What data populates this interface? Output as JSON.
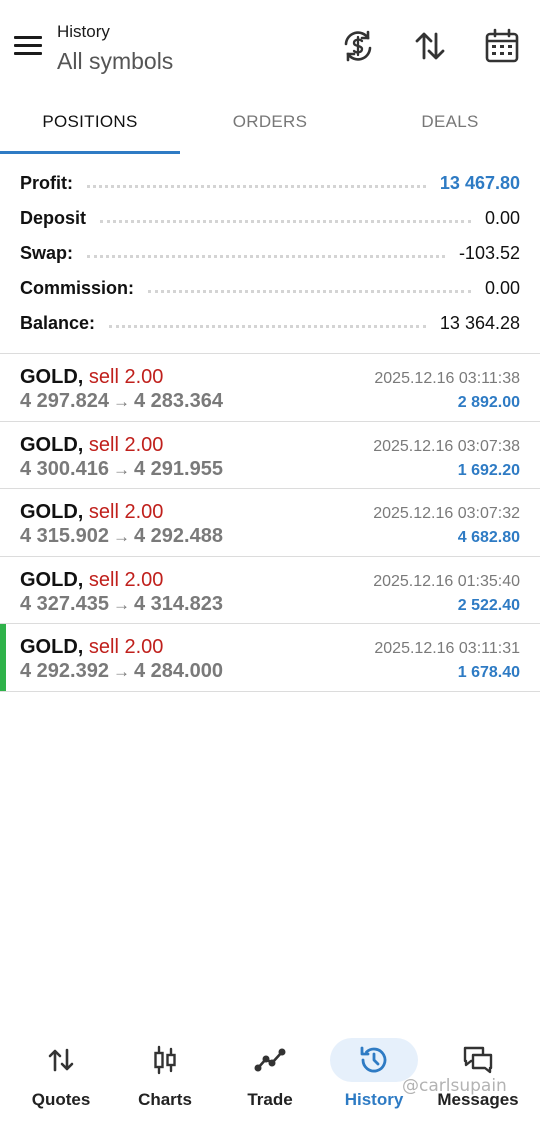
{
  "header": {
    "title": "History",
    "subtitle": "All symbols",
    "icons": [
      "menu-icon",
      "currency-exchange-icon",
      "sort-icon",
      "calendar-icon"
    ]
  },
  "tabs": [
    {
      "label": "POSITIONS",
      "active": true
    },
    {
      "label": "ORDERS",
      "active": false
    },
    {
      "label": "DEALS",
      "active": false
    }
  ],
  "summary": [
    {
      "label": "Profit:",
      "value": "13 467.80"
    },
    {
      "label": "Deposit",
      "value": "0.00"
    },
    {
      "label": "Swap:",
      "value": "-103.52"
    },
    {
      "label": "Commission:",
      "value": "0.00"
    },
    {
      "label": "Balance:",
      "value": "13 364.28"
    }
  ],
  "deals": [
    {
      "symbol": "GOLD,",
      "type": "sell 2.00",
      "open": "4 297.824",
      "arrow": "→",
      "close": "4 283.364",
      "time": "2025.12.16 03:11:38",
      "profit": "2 892.00"
    },
    {
      "symbol": "GOLD,",
      "type": "sell 2.00",
      "open": "4 300.416",
      "arrow": "→",
      "close": "4 291.955",
      "time": "2025.12.16 03:07:38",
      "profit": "1 692.20"
    },
    {
      "symbol": "GOLD,",
      "type": "sell 2.00",
      "open": "4 315.902",
      "arrow": "→",
      "close": "4 292.488",
      "time": "2025.12.16 03:07:32",
      "profit": "4 682.80"
    },
    {
      "symbol": "GOLD,",
      "type": "sell 2.00",
      "open": "4 327.435",
      "arrow": "→",
      "close": "4 314.823",
      "time": "2025.12.16 01:35:40",
      "profit": "2 522.40"
    },
    {
      "symbol": "GOLD,",
      "type": "sell 2.00",
      "open": "4 292.392",
      "arrow": "→",
      "close": "4 284.000",
      "time": "2025.12.16 03:11:31",
      "profit": "1 678.40"
    }
  ],
  "bottom_nav": [
    {
      "label": "Quotes",
      "icon": "quotes-icon",
      "active": false
    },
    {
      "label": "Charts",
      "icon": "candlestick-chart-icon",
      "active": false
    },
    {
      "label": "Trade",
      "icon": "trade-line-icon",
      "active": false
    },
    {
      "label": "History",
      "icon": "history-clock-icon",
      "active": true
    },
    {
      "label": "Messages",
      "icon": "messages-icon",
      "active": false
    }
  ],
  "watermark": "@carlsupain",
  "colors": {
    "accent": "#2e7bc4",
    "sell": "#c0201c",
    "marker": "#2fb24a"
  }
}
